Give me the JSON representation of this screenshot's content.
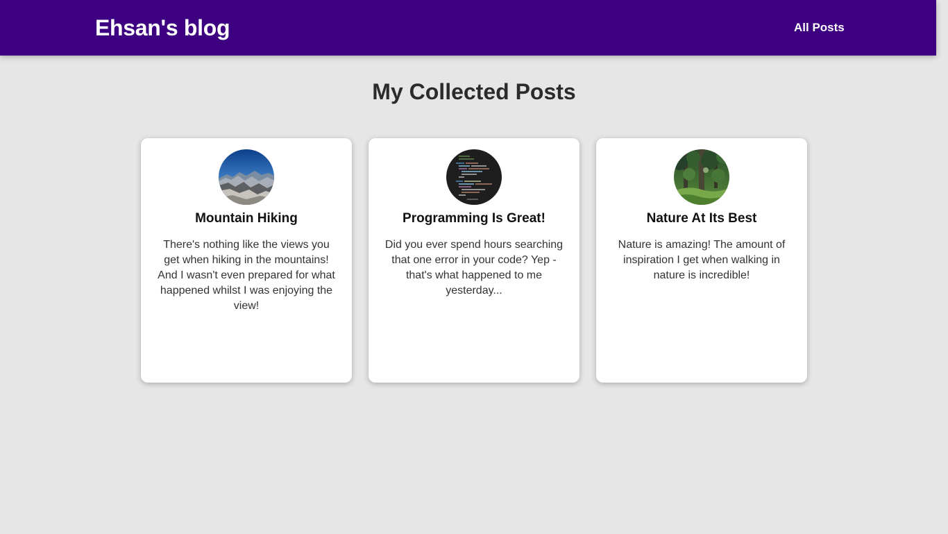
{
  "header": {
    "brand": "Ehsan's blog",
    "nav_all_posts": "All Posts",
    "background_color": "#3c0080"
  },
  "main": {
    "title": "My Collected Posts",
    "posts": [
      {
        "title": "Mountain Hiking",
        "excerpt": "There's nothing like the views you get when hiking in the mountains! And I wasn't even prepared for what happened whilst I was enjoying the view!",
        "image": "mountain-photo"
      },
      {
        "title": "Programming Is Great!",
        "excerpt": "Did you ever spend hours searching that one error in your code? Yep - that's what happened to me yesterday...",
        "image": "code-screenshot"
      },
      {
        "title": "Nature At Its Best",
        "excerpt": "Nature is amazing! The amount of inspiration I get when walking in nature is incredible!",
        "image": "forest-photo"
      }
    ]
  }
}
